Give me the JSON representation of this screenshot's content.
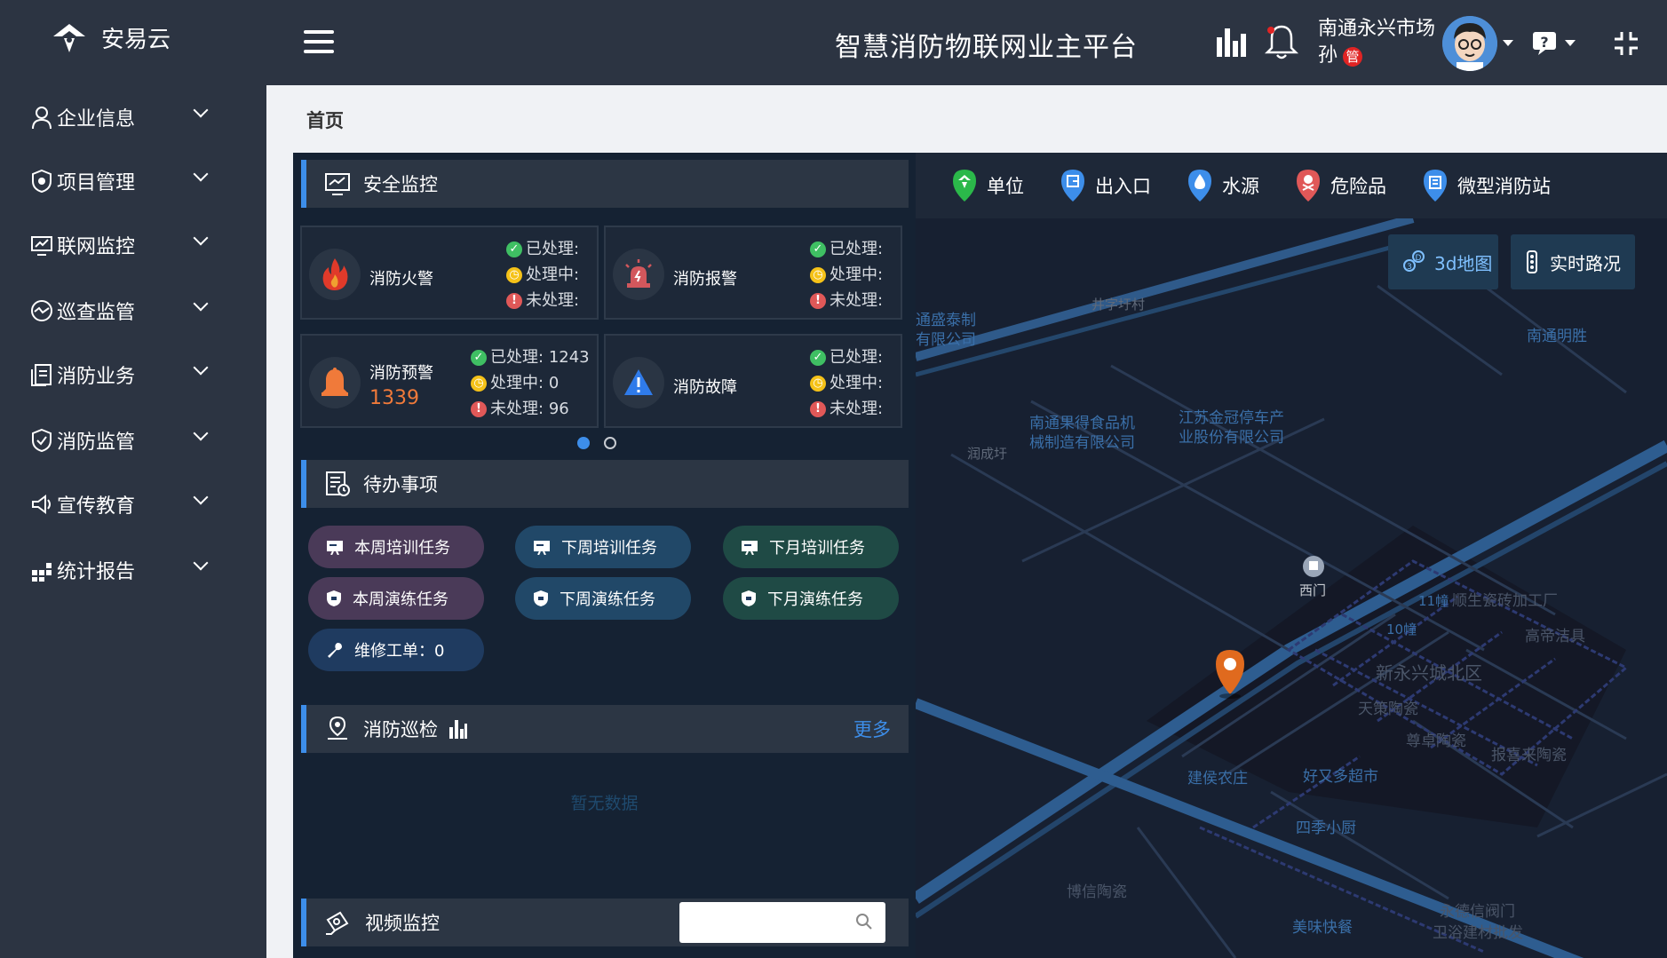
{
  "app": {
    "logo_text": "安易云",
    "title": "智慧消防物联网业主平台",
    "user_name": "南通永兴市场",
    "user_initial": "孙",
    "user_role_badge": "管"
  },
  "sidebar": {
    "items": [
      {
        "label": "企业信息",
        "icon": "person-icon"
      },
      {
        "label": "项目管理",
        "icon": "shield-icon"
      },
      {
        "label": "联网监控",
        "icon": "monitor-icon"
      },
      {
        "label": "巡查监管",
        "icon": "patrol-icon"
      },
      {
        "label": "消防业务",
        "icon": "document-icon"
      },
      {
        "label": "消防监管",
        "icon": "shield-check-icon"
      },
      {
        "label": "宣传教育",
        "icon": "megaphone-icon"
      },
      {
        "label": "统计报告",
        "icon": "grid-icon"
      }
    ]
  },
  "breadcrumb": "首页",
  "security": {
    "title": "安全监控",
    "cards": [
      {
        "title": "消防火警",
        "count": "",
        "processed_label": "已处理:",
        "processed": "",
        "processing_label": "处理中:",
        "processing": "",
        "unprocessed_label": "未处理:",
        "unprocessed": ""
      },
      {
        "title": "消防报警",
        "count": "",
        "processed_label": "已处理:",
        "processed": "",
        "processing_label": "处理中:",
        "processing": "",
        "unprocessed_label": "未处理:",
        "unprocessed": ""
      },
      {
        "title": "消防预警",
        "count": "1339",
        "processed_label": "已处理:",
        "processed": "1243",
        "processing_label": "处理中:",
        "processing": "0",
        "unprocessed_label": "未处理:",
        "unprocessed": "96"
      },
      {
        "title": "消防故障",
        "count": "",
        "processed_label": "已处理:",
        "processed": "",
        "processing_label": "处理中:",
        "processing": "",
        "unprocessed_label": "未处理:",
        "unprocessed": ""
      }
    ],
    "page_current": 1,
    "page_total": 2
  },
  "todo": {
    "title": "待办事项",
    "buttons": [
      {
        "label": "本周培训任务"
      },
      {
        "label": "下周培训任务"
      },
      {
        "label": "下月培训任务"
      },
      {
        "label": "本周演练任务"
      },
      {
        "label": "下周演练任务"
      },
      {
        "label": "下月演练任务"
      },
      {
        "label": "维修工单：0"
      }
    ]
  },
  "patrol": {
    "title": "消防巡检",
    "more": "更多",
    "empty": "暂无数据"
  },
  "video": {
    "title": "视频监控",
    "search_placeholder": ""
  },
  "map": {
    "legend": [
      {
        "label": "单位",
        "color": "#2bb84a"
      },
      {
        "label": "出入口",
        "color": "#3d8eea"
      },
      {
        "label": "水源",
        "color": "#3d8eea"
      },
      {
        "label": "危险品",
        "color": "#e05858"
      },
      {
        "label": "微型消防站",
        "color": "#3d8eea"
      }
    ],
    "btn_3d": "3d地图",
    "btn_traffic": "实时路况",
    "labels": {
      "l1": "通盛泰制",
      "l2": "有限公司",
      "l3": "井字圩村",
      "l4": "南通明胜",
      "l5": "南通果得食品机",
      "l6": "械制造有限公司",
      "l7": "江苏金冠停车产",
      "l8": "业股份有限公司",
      "l9": "润成圩",
      "l10": "西门",
      "l11": "11幢",
      "l12": "顺生瓷砖加工厂",
      "l13": "10幢",
      "l14": "高帝洁具",
      "l15": "新永兴城北区",
      "l16": "天策陶瓷",
      "l17": "尊卓陶瓷",
      "l18": "报喜来陶瓷",
      "l19": "建侯农庄",
      "l20": "好又多超市",
      "l21": "四季小厨",
      "l22": "博信陶瓷",
      "l23": "美味快餐",
      "l24": "永德信阀门",
      "l25": "卫浴建材批发"
    }
  }
}
